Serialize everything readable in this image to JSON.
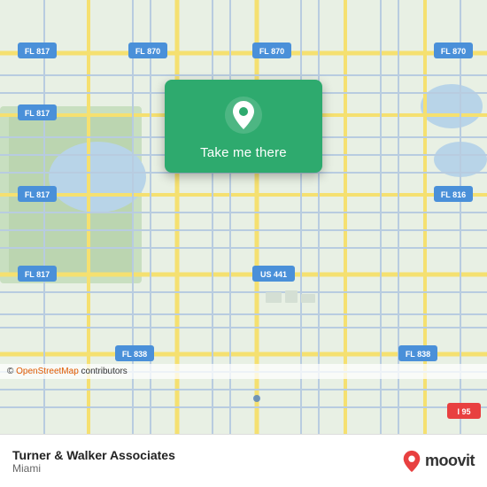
{
  "map": {
    "attribution": "© OpenStreetMap contributors",
    "attribution_link": "OpenStreetMap",
    "background_color": "#e8efe8"
  },
  "card": {
    "button_label": "Take me there",
    "pin_icon": "location-pin"
  },
  "bottom_bar": {
    "location_name": "Turner & Walker Associates",
    "location_city": "Miami",
    "brand_name": "moovit"
  }
}
